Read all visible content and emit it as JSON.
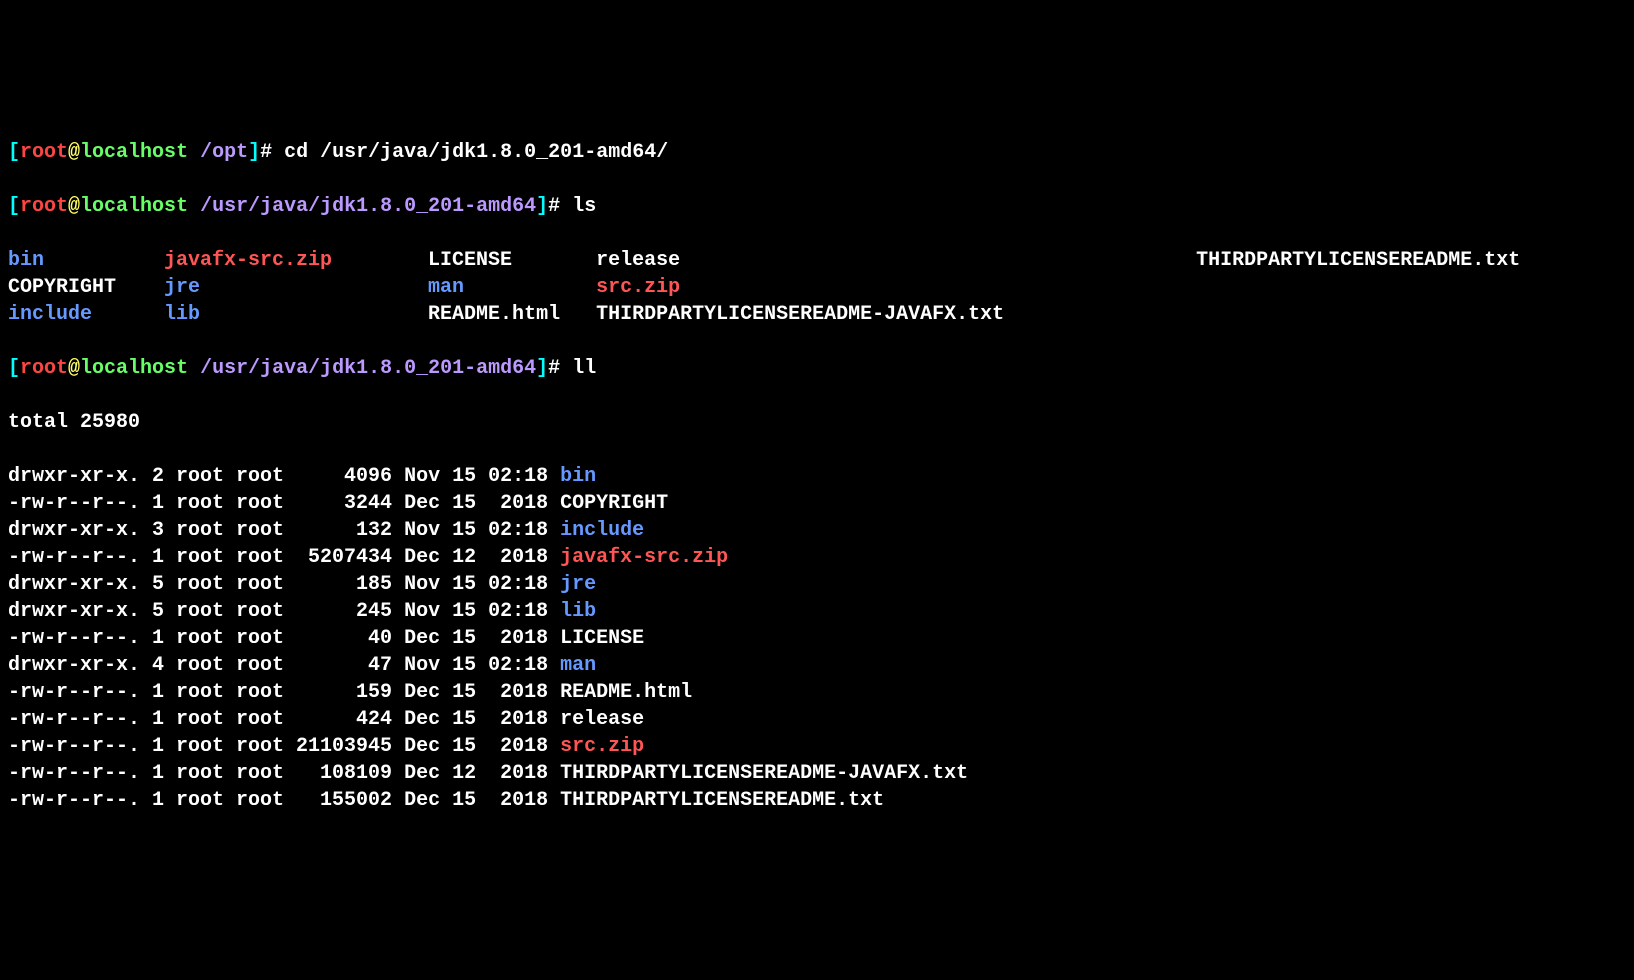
{
  "prompts": [
    {
      "user": "root",
      "at": "@",
      "host": "localhost",
      "path": "/opt",
      "bracket_open": "[",
      "bracket_close": "]",
      "dollar": "# ",
      "command": "cd /usr/java/jdk1.8.0_201-amd64/"
    },
    {
      "user": "root",
      "at": "@",
      "host": "localhost",
      "path": "/usr/java/jdk1.8.0_201-amd64",
      "bracket_open": "[",
      "bracket_close": "]",
      "dollar": "# ",
      "command": "ls"
    },
    {
      "user": "root",
      "at": "@",
      "host": "localhost",
      "path": "/usr/java/jdk1.8.0_201-amd64",
      "bracket_open": "[",
      "bracket_close": "]",
      "dollar": "# ",
      "command": "ll"
    }
  ],
  "ls_output": [
    {
      "c1": {
        "text": "bin",
        "type": "dir"
      },
      "c2": {
        "text": "javafx-src.zip",
        "type": "zip"
      },
      "c3": {
        "text": "LICENSE",
        "type": "white"
      },
      "c4": {
        "text": "release",
        "type": "white"
      },
      "c5": {
        "text": "THIRDPARTYLICENSEREADME.txt",
        "type": "white"
      }
    },
    {
      "c1": {
        "text": "COPYRIGHT",
        "type": "white"
      },
      "c2": {
        "text": "jre",
        "type": "dir"
      },
      "c3": {
        "text": "man",
        "type": "dir"
      },
      "c4": {
        "text": "src.zip",
        "type": "zip"
      },
      "c5": {
        "text": "",
        "type": "white"
      }
    },
    {
      "c1": {
        "text": "include",
        "type": "dir"
      },
      "c2": {
        "text": "lib",
        "type": "dir"
      },
      "c3": {
        "text": "README.html",
        "type": "white"
      },
      "c4": {
        "text": "THIRDPARTYLICENSEREADME-JAVAFX.txt",
        "type": "white"
      },
      "c5": {
        "text": "",
        "type": "white"
      }
    }
  ],
  "ll_total": "total 25980",
  "ll_rows": [
    {
      "perms": "drwxr-xr-x. 2 root root     4096 Nov 15 02:18 ",
      "name": "bin",
      "type": "dir"
    },
    {
      "perms": "-rw-r--r--. 1 root root     3244 Dec 15  2018 ",
      "name": "COPYRIGHT",
      "type": "white"
    },
    {
      "perms": "drwxr-xr-x. 3 root root      132 Nov 15 02:18 ",
      "name": "include",
      "type": "dir"
    },
    {
      "perms": "-rw-r--r--. 1 root root  5207434 Dec 12  2018 ",
      "name": "javafx-src.zip",
      "type": "zip"
    },
    {
      "perms": "drwxr-xr-x. 5 root root      185 Nov 15 02:18 ",
      "name": "jre",
      "type": "dir"
    },
    {
      "perms": "drwxr-xr-x. 5 root root      245 Nov 15 02:18 ",
      "name": "lib",
      "type": "dir"
    },
    {
      "perms": "-rw-r--r--. 1 root root       40 Dec 15  2018 ",
      "name": "LICENSE",
      "type": "white"
    },
    {
      "perms": "drwxr-xr-x. 4 root root       47 Nov 15 02:18 ",
      "name": "man",
      "type": "dir"
    },
    {
      "perms": "-rw-r--r--. 1 root root      159 Dec 15  2018 ",
      "name": "README.html",
      "type": "white"
    },
    {
      "perms": "-rw-r--r--. 1 root root      424 Dec 15  2018 ",
      "name": "release",
      "type": "white"
    },
    {
      "perms": "-rw-r--r--. 1 root root 21103945 Dec 15  2018 ",
      "name": "src.zip",
      "type": "zip"
    },
    {
      "perms": "-rw-r--r--. 1 root root   108109 Dec 12  2018 ",
      "name": "THIRDPARTYLICENSEREADME-JAVAFX.txt",
      "type": "white"
    },
    {
      "perms": "-rw-r--r--. 1 root root   155002 Dec 15  2018 ",
      "name": "THIRDPARTYLICENSEREADME.txt",
      "type": "white"
    }
  ]
}
